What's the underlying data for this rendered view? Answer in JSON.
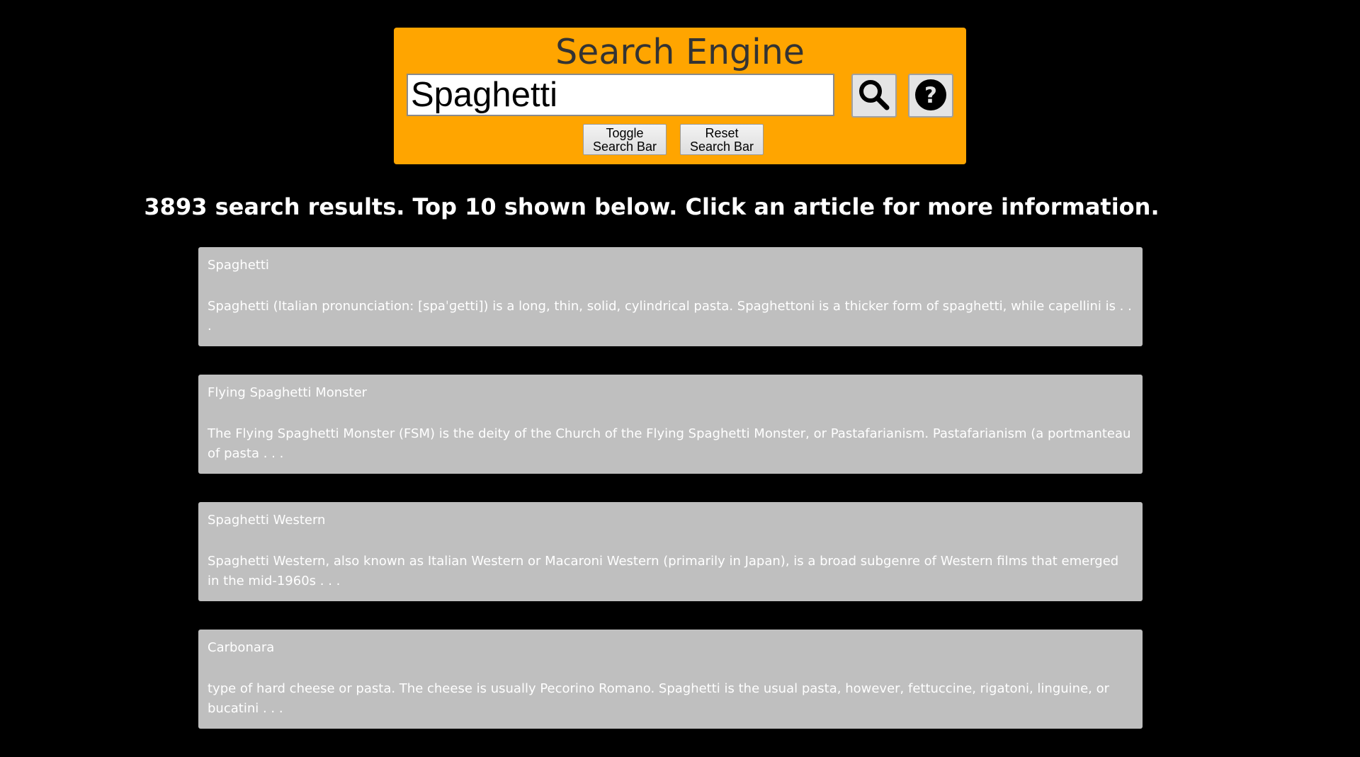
{
  "header": {
    "title": "Search Engine",
    "search_value": "Spaghetti",
    "search_icon": "magnifier-icon",
    "help_icon": "question-circle-icon",
    "toggle_label_line1": "Toggle",
    "toggle_label_line2": "Search Bar",
    "reset_label_line1": "Reset",
    "reset_label_line2": "Search Bar",
    "accent_color": "#FFA500"
  },
  "results_summary": "3893 search results. Top 10 shown below. Click an article for more information.",
  "results": [
    {
      "title": "Spaghetti",
      "snippet": "Spaghetti (Italian pronunciation: [spaˈɡetti]) is a long, thin, solid, cylindrical pasta. Spaghettoni is a thicker form of spaghetti, while capellini is . . ."
    },
    {
      "title": "Flying Spaghetti Monster",
      "snippet": "The Flying Spaghetti Monster (FSM) is the deity of the Church of the Flying Spaghetti Monster, or Pastafarianism. Pastafarianism (a portmanteau of pasta . . ."
    },
    {
      "title": "Spaghetti Western",
      "snippet": "Spaghetti Western, also known as Italian Western or Macaroni Western (primarily in Japan), is a broad subgenre of Western films that emerged in the mid-1960s . . ."
    },
    {
      "title": "Carbonara",
      "snippet": "type of hard cheese or pasta. The cheese is usually Pecorino Romano. Spaghetti is the usual pasta, however, fettuccine, rigatoni, linguine, or bucatini . . ."
    }
  ]
}
